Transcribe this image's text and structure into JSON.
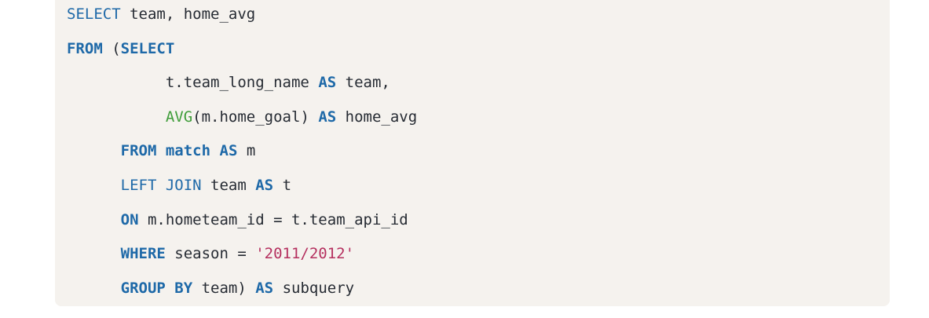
{
  "code_block": {
    "language": "sql",
    "colors": {
      "keyword": "#1e69a8",
      "function": "#3f9d3a",
      "string": "#b5305f",
      "text": "#262b33",
      "background": "#f5f2ee"
    },
    "lines": [
      {
        "indent": "",
        "tokens": [
          {
            "type": "kw-light",
            "text": "SELECT"
          },
          {
            "type": "plain",
            "text": " team, home_avg"
          }
        ]
      },
      {
        "indent": "",
        "tokens": [
          {
            "type": "kw",
            "text": "FROM"
          },
          {
            "type": "plain",
            "text": " ("
          },
          {
            "type": "kw",
            "text": "SELECT"
          }
        ]
      },
      {
        "indent": "           ",
        "tokens": [
          {
            "type": "plain",
            "text": "t.team_long_name "
          },
          {
            "type": "kw",
            "text": "AS"
          },
          {
            "type": "plain",
            "text": " team,"
          }
        ]
      },
      {
        "indent": "           ",
        "tokens": [
          {
            "type": "fn",
            "text": "AVG"
          },
          {
            "type": "plain",
            "text": "(m.home_goal) "
          },
          {
            "type": "kw",
            "text": "AS"
          },
          {
            "type": "plain",
            "text": " home_avg"
          }
        ]
      },
      {
        "indent": "      ",
        "tokens": [
          {
            "type": "kw",
            "text": "FROM"
          },
          {
            "type": "plain",
            "text": " "
          },
          {
            "type": "kw",
            "text": "match"
          },
          {
            "type": "plain",
            "text": " "
          },
          {
            "type": "kw",
            "text": "AS"
          },
          {
            "type": "plain",
            "text": " m"
          }
        ]
      },
      {
        "indent": "      ",
        "tokens": [
          {
            "type": "kw-light",
            "text": "LEFT JOIN"
          },
          {
            "type": "plain",
            "text": " team "
          },
          {
            "type": "kw",
            "text": "AS"
          },
          {
            "type": "plain",
            "text": " t"
          }
        ]
      },
      {
        "indent": "      ",
        "tokens": [
          {
            "type": "kw",
            "text": "ON"
          },
          {
            "type": "plain",
            "text": " m.hometeam_id = t.team_api_id"
          }
        ]
      },
      {
        "indent": "      ",
        "tokens": [
          {
            "type": "kw",
            "text": "WHERE"
          },
          {
            "type": "plain",
            "text": " season = "
          },
          {
            "type": "str",
            "text": "'2011/2012'"
          }
        ]
      },
      {
        "indent": "      ",
        "tokens": [
          {
            "type": "kw",
            "text": "GROUP BY"
          },
          {
            "type": "plain",
            "text": " team) "
          },
          {
            "type": "kw",
            "text": "AS"
          },
          {
            "type": "plain",
            "text": " subquery"
          }
        ]
      }
    ]
  }
}
